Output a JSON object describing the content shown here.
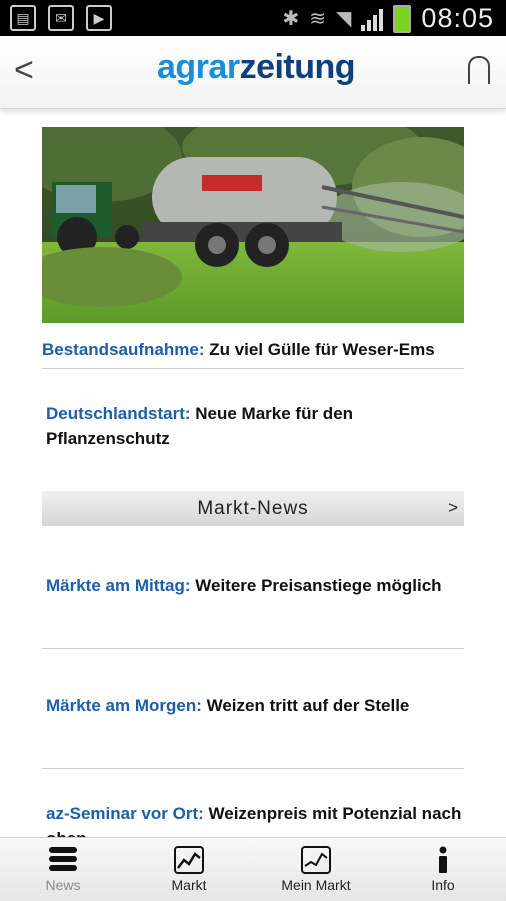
{
  "status_bar": {
    "time": "08:05",
    "icons": [
      "sd-card-icon",
      "missed-email-icon",
      "play-store-icon",
      "bluetooth-icon",
      "vibrate-icon",
      "wifi-icon",
      "signal-icon",
      "battery-icon"
    ]
  },
  "header": {
    "logo_part1": "agrar",
    "logo_part2": "zeitung",
    "back_label": "<",
    "colors": {
      "logo_light": "#1a8fd8",
      "logo_dark": "#0f3f7c",
      "link_blue": "#1c5fa8"
    }
  },
  "articles": [
    {
      "kicker": "Bestandsaufnahme:",
      "title": "Zu viel Gülle für Weser-Ems"
    },
    {
      "kicker": "Deutschlandstart:",
      "title": "Neue Marke für den Pflanzenschutz"
    }
  ],
  "section": {
    "title": "Markt-News",
    "arrow": ">"
  },
  "market_news": [
    {
      "kicker": "Märkte am Mittag:",
      "title": "Weitere Preisanstiege möglich"
    },
    {
      "kicker": "Märkte am Morgen:",
      "title": "Weizen tritt auf der Stelle"
    },
    {
      "kicker": "az-Seminar vor Ort:",
      "title": "Weizenpreis mit Potenzial nach oben"
    }
  ],
  "tabs": [
    {
      "label": "News",
      "icon": "menu-icon",
      "active": true
    },
    {
      "label": "Markt",
      "icon": "chart-icon",
      "active": false
    },
    {
      "label": "Mein Markt",
      "icon": "chart-icon",
      "active": false
    },
    {
      "label": "Info",
      "icon": "info-icon",
      "active": false
    }
  ]
}
